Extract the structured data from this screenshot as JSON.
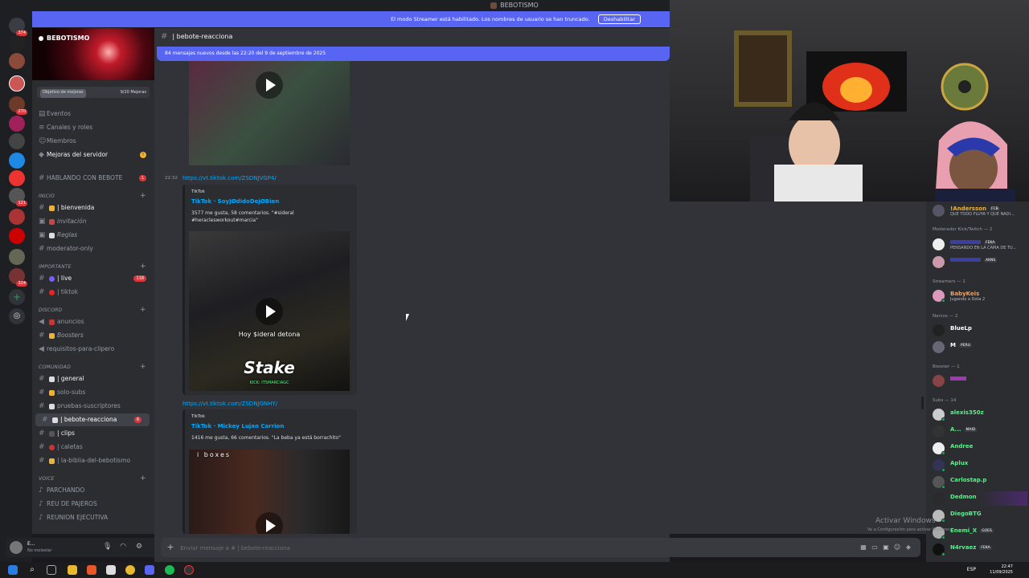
{
  "window": {
    "title": "BEBOTISMO"
  },
  "streamer_bar": {
    "text": "El modo Streamer está habilitado. Los nombres de usuario se han truncado.",
    "button": "Deshabilitar"
  },
  "server": {
    "name": "BEBOTISMO",
    "boost_goal": "Objetivo de mejoras",
    "boost_count": "9/20 Mejoras",
    "nav": [
      "Eventos",
      "Canales y roles",
      "Miembros",
      "Mejoras del servidor"
    ],
    "hablando": "HABLANDO CON BEBOTE",
    "hablando_count": "1",
    "categories": {
      "inicio": "INICIO",
      "importante": "IMPORTANTE",
      "discord": "DISCORD",
      "comunidad": "COMUNIDAD",
      "voice": "VOICE"
    },
    "channels": {
      "bienvenida": "| bienvenida",
      "invitacion": "invitación",
      "reglas": "Reglas",
      "moderator": "moderator-only",
      "live": "| live",
      "live_count": "118",
      "tiktok": "| tiktok",
      "anuncios": "anuncios",
      "boosters": "Boosters",
      "requisitos": "requisitos-para-clipero",
      "general": "| general",
      "solo_subs": "solo-subs",
      "pruebas": "pruebas-suscriptores",
      "bebote": "| bebote-reacciona",
      "bebote_count": "6",
      "clips": "| clips",
      "caletas": "| caletas",
      "biblia": "| la-biblia-del-bebotismo",
      "parchando": "PARCHANDO",
      "reu": "REU DE PAJEROS",
      "reunion": "REUNION EJECUTIVA"
    }
  },
  "user_panel": {
    "name": "E...",
    "status": "No molestar"
  },
  "channel_header": {
    "name": "| bebote-reacciona"
  },
  "new_messages": "84 mensajes nuevos desde las 22:20 del 9 de septiembre de 2025",
  "messages": [
    {
      "time": "22:32",
      "link": "https://vt.tiktok.com/ZSDNJVGP4/",
      "provider": "TikTok",
      "title": "TikTok · SoyJØdidoDejØBien",
      "desc": "3577 me gusta, 58 comentarios. \"#sideral #heraclesworkout#marcia\"",
      "overlay": "Hoy $ideral detona",
      "overlay_brand": "Stake",
      "overlay_tag": "KICK: ITSMARCIAGC"
    },
    {
      "link": "https://vt.tiktok.com/ZSDNJGNHY/",
      "provider": "TikTok",
      "title": "TikTok · Mickey Lujan Carrion",
      "desc": "1416 me gusta, 66 comentarios. \"La beba ya está borrachito\"",
      "overlay": "i boxes"
    }
  ],
  "composer": {
    "placeholder": "Enviar mensaje a # | bebote-reacciona"
  },
  "members": {
    "top": {
      "name": "!Andersson",
      "tag": "FCB",
      "sub": "QUE TODO FLUYA Y QUE NADI..."
    },
    "cat_mod": "Moderador Kick/Twitch — 2",
    "mod1": {
      "tag": "FEKA",
      "sub": "PENSANDO EN LA CAMA DE TU..."
    },
    "mod2": {
      "tag": "AKNS"
    },
    "cat_streamers": "Streamers — 1",
    "streamer1": {
      "name": "BabyKeis",
      "sub": "Jugando a Dota 2"
    },
    "cat_narcos": "Narcos — 2",
    "narco1": {
      "name": "BlueLp"
    },
    "narco2": {
      "name": "M",
      "tag": "PERU"
    },
    "cat_booster": "Booster — 1",
    "cat_subs": "Subs — 14",
    "subs": [
      {
        "name": "alexis350z",
        "color": "#57f287"
      },
      {
        "name": "A...",
        "tag": "MAID",
        "color": "#57f287"
      },
      {
        "name": "Andree",
        "color": "#57f287"
      },
      {
        "name": "Aplux",
        "color": "#57f287"
      },
      {
        "name": "Carlostap.p",
        "color": "#57f287"
      },
      {
        "name": "Dedmon",
        "color": "#57f287"
      },
      {
        "name": "DiegoBTG",
        "color": "#57f287"
      },
      {
        "name": "Enemi_X",
        "tag": "GOES",
        "color": "#57f287"
      },
      {
        "name": "N4rvaez",
        "tag": "FEKA",
        "color": "#57f287"
      }
    ]
  },
  "watermark": {
    "title": "Activar Windows",
    "sub": "Ve a Configuración para activar Windows."
  },
  "taskbar": {
    "lang": "ESP",
    "time": "22:47",
    "date": "11/09/2025"
  },
  "colors": {
    "accent": "#5865f2",
    "link": "#00a8fc",
    "danger": "#da373c",
    "sub_green": "#57f287"
  }
}
